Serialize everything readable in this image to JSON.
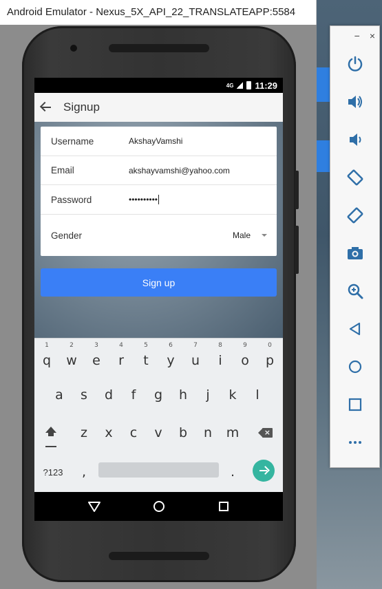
{
  "window": {
    "title": "Android Emulator - Nexus_5X_API_22_TRANSLATEAPP:5584"
  },
  "statusbar": {
    "network": "4G",
    "time": "11:29"
  },
  "appbar": {
    "title": "Signup"
  },
  "form": {
    "username_label": "Username",
    "username_value": "AkshayVamshi",
    "email_label": "Email",
    "email_value": "akshayvamshi@yahoo.com",
    "password_label": "Password",
    "password_value": "••••••••••",
    "gender_label": "Gender",
    "gender_value": "Male"
  },
  "signup_button": {
    "label": "Sign up"
  },
  "keyboard": {
    "row1": [
      {
        "hint": "1",
        "key": "q"
      },
      {
        "hint": "2",
        "key": "w"
      },
      {
        "hint": "3",
        "key": "e"
      },
      {
        "hint": "4",
        "key": "r"
      },
      {
        "hint": "5",
        "key": "t"
      },
      {
        "hint": "6",
        "key": "y"
      },
      {
        "hint": "7",
        "key": "u"
      },
      {
        "hint": "8",
        "key": "i"
      },
      {
        "hint": "9",
        "key": "o"
      },
      {
        "hint": "0",
        "key": "p"
      }
    ],
    "row2": [
      "a",
      "s",
      "d",
      "f",
      "g",
      "h",
      "j",
      "k",
      "l"
    ],
    "row3": [
      "z",
      "x",
      "c",
      "v",
      "b",
      "n",
      "m"
    ],
    "symbols_key": "?123",
    "comma_key": ",",
    "period_key": "."
  },
  "colors": {
    "accent": "#3a7ff6",
    "enter_key": "#35b5a0",
    "appbar_bg": "#f5f5f5",
    "keyboard_bg": "#edeff1"
  },
  "toolbar": {
    "minimize": "−",
    "close": "×",
    "icons": [
      "power-icon",
      "volume-up-icon",
      "volume-down-icon",
      "rotate-left-icon",
      "rotate-right-icon",
      "camera-icon",
      "zoom-icon",
      "back-icon",
      "home-icon",
      "overview-icon",
      "more-icon"
    ]
  }
}
